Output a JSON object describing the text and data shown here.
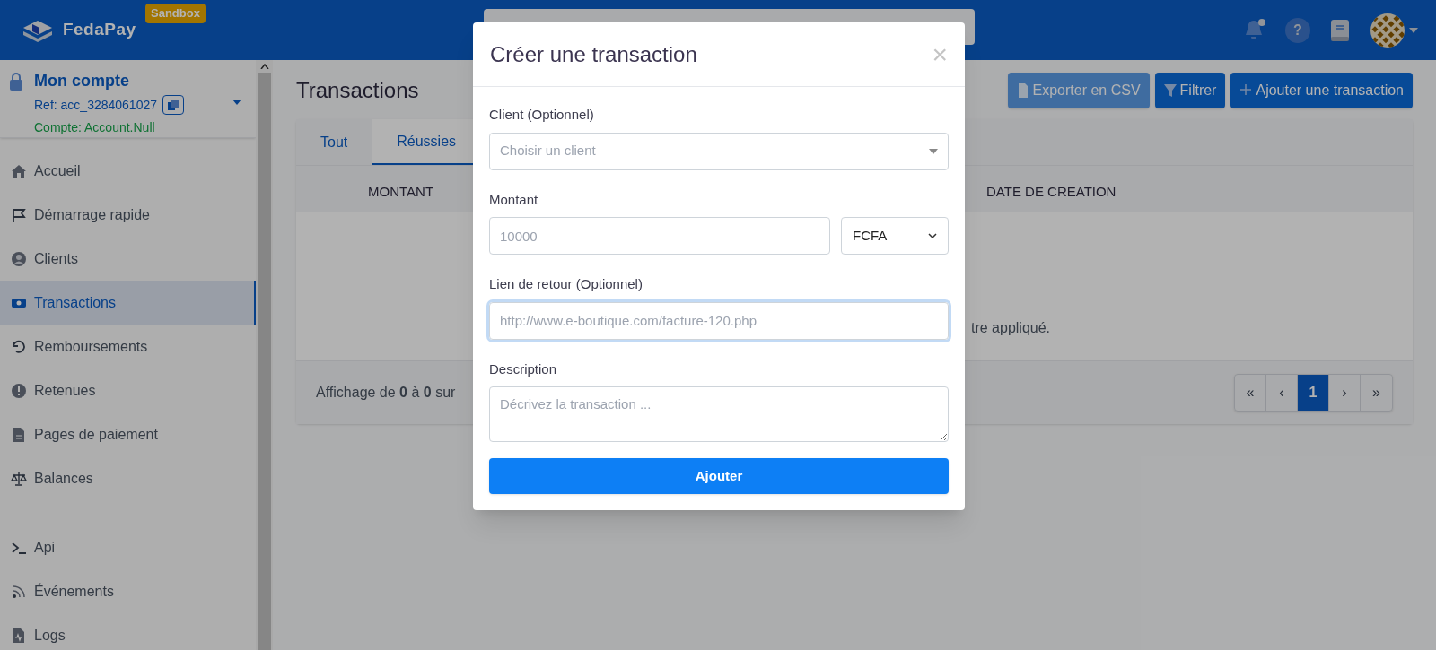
{
  "header": {
    "logo": "FedaPay",
    "badge": "Sandbox",
    "notification_dot": true,
    "help": "?"
  },
  "account": {
    "title": "Mon compte",
    "ref": "Ref: acc_3284061027",
    "compte": "Compte: Account.Null"
  },
  "sidebar": {
    "items": [
      {
        "label": "Accueil",
        "selected": false
      },
      {
        "label": "Démarrage rapide",
        "selected": false
      },
      {
        "label": "Clients",
        "selected": false
      },
      {
        "label": "Transactions",
        "selected": true
      },
      {
        "label": "Remboursements",
        "selected": false
      },
      {
        "label": "Retenues",
        "selected": false
      },
      {
        "label": "Pages de paiement",
        "selected": false
      },
      {
        "label": "Balances",
        "selected": false
      }
    ],
    "items_2": [
      {
        "label": "Api",
        "selected": false
      },
      {
        "label": "Événements",
        "selected": false
      },
      {
        "label": "Logs",
        "selected": false
      }
    ]
  },
  "page": {
    "title": "Transactions",
    "buttons": [
      {
        "label": "Exporter en CSV",
        "kind": "export",
        "disabled": true
      },
      {
        "label": "Filtrer",
        "kind": "filter",
        "disabled": false
      },
      {
        "label": "Ajouter une transaction",
        "kind": "add",
        "disabled": false
      }
    ]
  },
  "tabs": [
    {
      "label": "Tout",
      "selected": false
    },
    {
      "label": "Réussies",
      "selected": true
    }
  ],
  "table": {
    "columns": [
      "MONTANT",
      "DATE DE CREATION"
    ],
    "empty_message": "tre appliqué.",
    "footer": "Affichage de **0** à **0** sur"
  },
  "pagination": [
    {
      "label": "«",
      "selected": false
    },
    {
      "label": "‹",
      "selected": false
    },
    {
      "label": "1",
      "selected": true
    },
    {
      "label": "›",
      "selected": false
    },
    {
      "label": "»",
      "selected": false
    }
  ],
  "modal": {
    "title": "Créer une transaction",
    "close": "×",
    "client": {
      "label": "Client (Optionnel)",
      "placeholder": "Choisir un client"
    },
    "montant": {
      "label": "Montant",
      "placeholder": "10000",
      "currency": "FCFA"
    },
    "lien": {
      "label": "Lien de retour (Optionnel)",
      "placeholder": "http://www.e-boutique.com/facture-120.php",
      "focused": true
    },
    "description": {
      "label": "Description",
      "placeholder": "Décrivez la transaction ..."
    },
    "submit": "Ajouter"
  }
}
